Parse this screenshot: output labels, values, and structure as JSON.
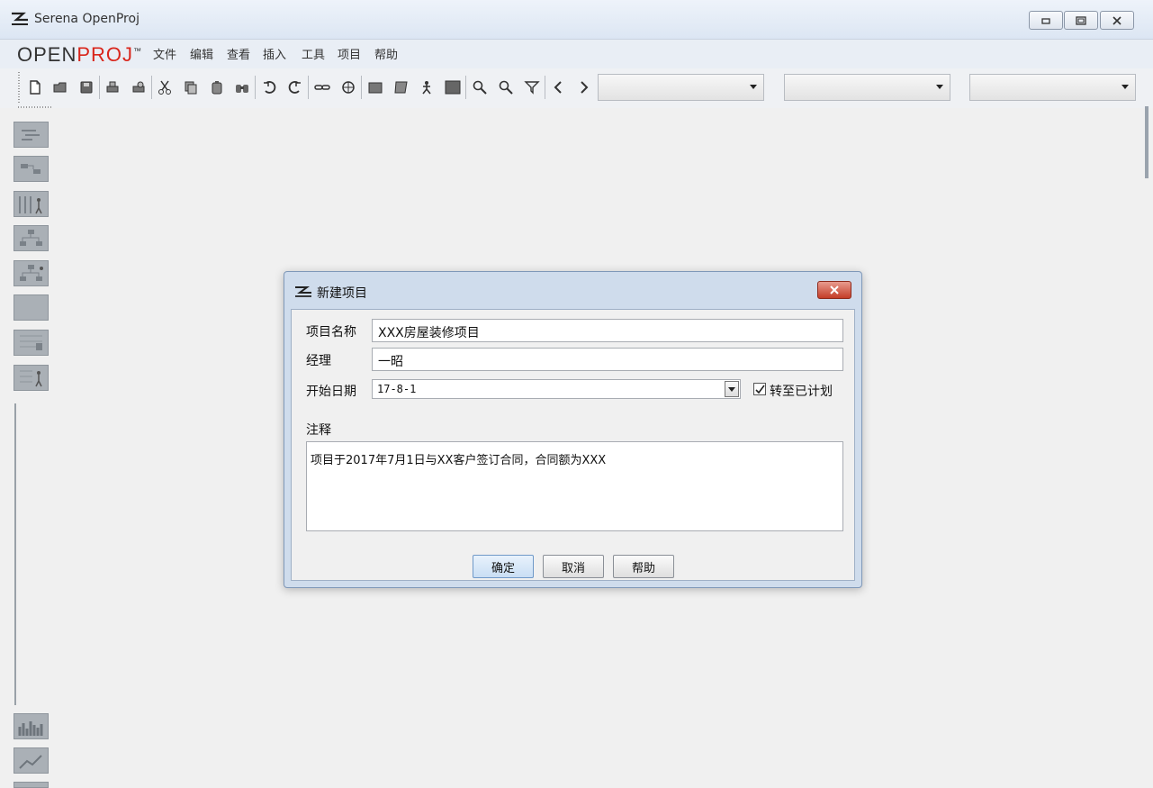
{
  "window": {
    "title": "Serena OpenProj",
    "icons": [
      "app-logo-icon",
      "minimize-icon",
      "maximize-icon",
      "close-icon"
    ]
  },
  "brand": {
    "open": "OPEN",
    "proj": "PROJ",
    "mark": "™"
  },
  "menu": [
    "文件",
    "编辑",
    "查看",
    "插入",
    "工具",
    "项目",
    "帮助"
  ],
  "toolbar": {
    "icons": [
      "new-icon",
      "open-icon",
      "save-icon",
      "print-icon",
      "print-preview-icon",
      "cut-icon",
      "copy-icon",
      "paste-icon",
      "find-icon",
      "undo-icon",
      "redo-icon",
      "link-icon",
      "unlink-icon",
      "task-info-icon",
      "notes-icon",
      "resource-icon",
      "calendar-icon",
      "zoom-in-icon",
      "zoom-out-icon",
      "filter-icon",
      "scroll-left-icon",
      "scroll-right-icon"
    ],
    "filters": [
      "",
      "",
      ""
    ]
  },
  "views": [
    "gantt-view-icon",
    "network-view-icon",
    "resource-sheet-icon",
    "wbs-view-icon",
    "rbs-view-icon",
    "project-view-icon",
    "task-usage-icon",
    "resource-usage-icon",
    "histogram-icon",
    "charts-icon"
  ],
  "dialog": {
    "title": "新建项目",
    "name_label": "项目名称",
    "name_value": "XXX房屋装修项目",
    "manager_label": "经理",
    "manager_value": "一昭",
    "start_label": "开始日期",
    "start_value": "17-8-1",
    "forward_label": "转至已计划",
    "forward_checked": true,
    "notes_label": "注释",
    "notes_value": "项目于2017年7月1日与XX客户签订合同，合同额为XXX",
    "ok": "确定",
    "cancel": "取消",
    "help": "帮助"
  }
}
